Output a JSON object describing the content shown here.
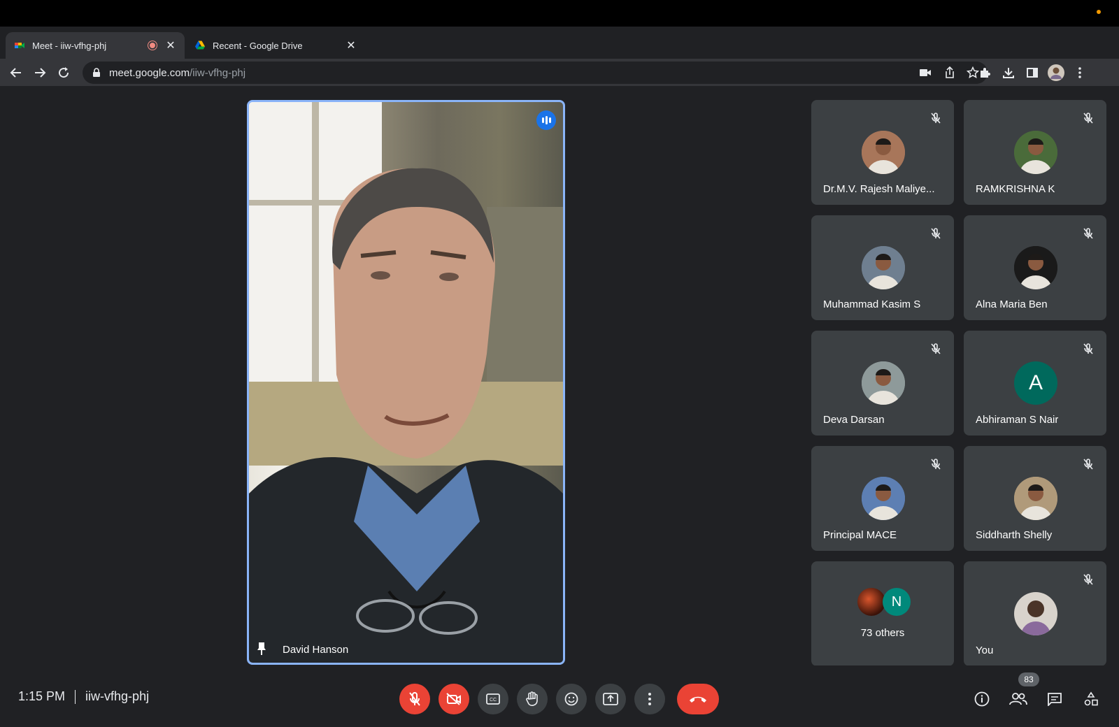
{
  "browser": {
    "tabs": [
      {
        "title": "Meet - iiw-vfhg-phj",
        "favicon": "google-meet-icon",
        "recording": true,
        "active": true
      },
      {
        "title": "Recent - Google Drive",
        "favicon": "google-drive-icon",
        "active": false
      }
    ],
    "url_host": "meet.google.com",
    "url_path": "/iiw-vfhg-phj"
  },
  "main_participant": {
    "name": "David Hanson",
    "speaking": true,
    "pinned": true
  },
  "participants": [
    {
      "name": "Dr.M.V. Rajesh Maliye...",
      "muted": true,
      "avatar": "photo",
      "avatar_color": "#a8765a"
    },
    {
      "name": "RAMKRISHNA K",
      "muted": true,
      "avatar": "photo",
      "avatar_color": "#4a6b3a"
    },
    {
      "name": "Muhammad Kasim S",
      "muted": true,
      "avatar": "photo",
      "avatar_color": "#6f7f90"
    },
    {
      "name": "Alna Maria Ben",
      "muted": true,
      "avatar": "photo",
      "avatar_color": "#1a1a1a"
    },
    {
      "name": "Deva Darsan",
      "muted": true,
      "avatar": "photo",
      "avatar_color": "#8e9a9a"
    },
    {
      "name": "Abhiraman S Nair",
      "muted": true,
      "avatar": "initial",
      "initial": "A",
      "avatar_color": "#00695c"
    },
    {
      "name": "Principal MACE",
      "muted": true,
      "avatar": "photo",
      "avatar_color": "#5d7fb3"
    },
    {
      "name": "Siddharth Shelly",
      "muted": true,
      "avatar": "photo",
      "avatar_color": "#b09a7a"
    }
  ],
  "others_tile": {
    "label": "73 others",
    "initial": "N",
    "initial_color": "#00897b"
  },
  "you_tile": {
    "label": "You",
    "muted": true
  },
  "meeting": {
    "time": "1:15 PM",
    "code": "iiw-vfhg-phj"
  },
  "controls": {
    "mic": "mic-off-icon",
    "camera": "camera-off-icon",
    "captions": "captions-icon",
    "raise_hand": "hand-icon",
    "reactions": "emoji-icon",
    "present": "present-icon",
    "more": "more-vert-icon",
    "end": "end-call-icon"
  },
  "people_count": "83",
  "colors": {
    "accent": "#8ab4f8",
    "danger": "#ea4335",
    "tile": "#3c4043",
    "bg": "#202124"
  }
}
